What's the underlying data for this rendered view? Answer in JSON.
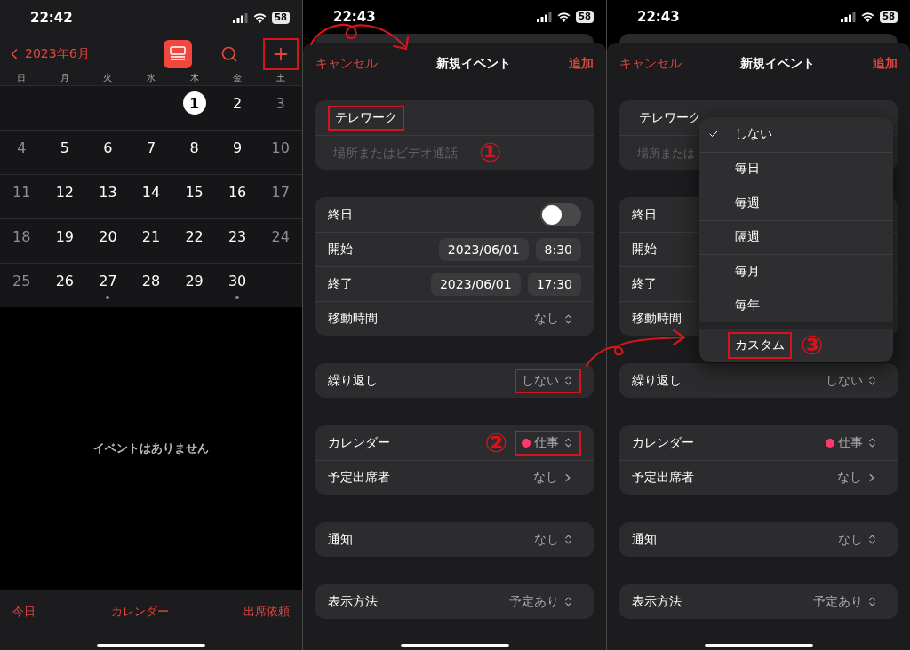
{
  "panels": [
    {
      "kind": "calendar",
      "status_bar": {
        "time": "22:42",
        "battery": "58"
      },
      "back_label": "2023年6月",
      "toolbar": [
        {
          "kind": "list",
          "selected": true,
          "highlighted": false
        },
        {
          "kind": "search",
          "selected": false,
          "highlighted": false
        },
        {
          "kind": "add",
          "selected": false,
          "highlighted": true
        }
      ],
      "weekdays": [
        "日",
        "月",
        "火",
        "水",
        "木",
        "金",
        "土"
      ],
      "weeks": [
        {
          "right_aligned": true,
          "days": [
            {
              "label": "1",
              "today": true,
              "weekend": false,
              "event": false
            },
            {
              "label": "2",
              "today": false,
              "weekend": false,
              "event": false
            },
            {
              "label": "3",
              "today": false,
              "weekend": true,
              "event": false
            }
          ]
        },
        {
          "right_aligned": false,
          "days": [
            {
              "label": "4",
              "today": false,
              "weekend": true,
              "event": false
            },
            {
              "label": "5",
              "today": false,
              "weekend": false,
              "event": false
            },
            {
              "label": "6",
              "today": false,
              "weekend": false,
              "event": false
            },
            {
              "label": "7",
              "today": false,
              "weekend": false,
              "event": false
            },
            {
              "label": "8",
              "today": false,
              "weekend": false,
              "event": false
            },
            {
              "label": "9",
              "today": false,
              "weekend": false,
              "event": false
            },
            {
              "label": "10",
              "today": false,
              "weekend": true,
              "event": false
            }
          ]
        },
        {
          "right_aligned": false,
          "days": [
            {
              "label": "11",
              "today": false,
              "weekend": true,
              "event": false
            },
            {
              "label": "12",
              "today": false,
              "weekend": false,
              "event": false
            },
            {
              "label": "13",
              "today": false,
              "weekend": false,
              "event": false
            },
            {
              "label": "14",
              "today": false,
              "weekend": false,
              "event": false
            },
            {
              "label": "15",
              "today": false,
              "weekend": false,
              "event": false
            },
            {
              "label": "16",
              "today": false,
              "weekend": false,
              "event": false
            },
            {
              "label": "17",
              "today": false,
              "weekend": true,
              "event": false
            }
          ]
        },
        {
          "right_aligned": false,
          "days": [
            {
              "label": "18",
              "today": false,
              "weekend": true,
              "event": false
            },
            {
              "label": "19",
              "today": false,
              "weekend": false,
              "event": false
            },
            {
              "label": "20",
              "today": false,
              "weekend": false,
              "event": false
            },
            {
              "label": "21",
              "today": false,
              "weekend": false,
              "event": false
            },
            {
              "label": "22",
              "today": false,
              "weekend": false,
              "event": false
            },
            {
              "label": "23",
              "today": false,
              "weekend": false,
              "event": false
            },
            {
              "label": "24",
              "today": false,
              "weekend": true,
              "event": false
            }
          ]
        },
        {
          "right_aligned": false,
          "days": [
            {
              "label": "25",
              "today": false,
              "weekend": true,
              "event": false
            },
            {
              "label": "26",
              "today": false,
              "weekend": false,
              "event": false
            },
            {
              "label": "27",
              "today": false,
              "weekend": false,
              "event": true
            },
            {
              "label": "28",
              "today": false,
              "weekend": false,
              "event": false
            },
            {
              "label": "29",
              "today": false,
              "weekend": false,
              "event": false
            },
            {
              "label": "30",
              "today": false,
              "weekend": false,
              "event": true
            }
          ]
        }
      ],
      "empty_message": "イベントはありません",
      "tabs": [
        "今日",
        "カレンダー",
        "出席依頼"
      ]
    },
    {
      "kind": "form",
      "status_bar": {
        "time": "22:43",
        "battery": "58"
      },
      "cancel": "キャンセル",
      "title": "新規イベント",
      "add": "追加",
      "groups": [
        {
          "rows": [
            {
              "kind": "text",
              "value": "テレワーク",
              "highlighted": true
            },
            {
              "kind": "placeholder",
              "placeholder": "場所またはビデオ通話",
              "callout": "①"
            }
          ]
        },
        {
          "rows": [
            {
              "kind": "toggle",
              "label": "終日",
              "on": false
            },
            {
              "kind": "datetime",
              "label": "開始",
              "date": "2023/06/01",
              "time": "8:30"
            },
            {
              "kind": "datetime",
              "label": "終了",
              "date": "2023/06/01",
              "time": "17:30"
            },
            {
              "kind": "select",
              "label": "移動時間",
              "value": "なし",
              "highlighted": false
            }
          ]
        },
        {
          "rows": [
            {
              "kind": "select",
              "label": "繰り返し",
              "value": "しない",
              "highlighted": true
            }
          ]
        },
        {
          "rows": [
            {
              "kind": "select",
              "label": "カレンダー",
              "value": "仕事",
              "color": "#ff3b6b",
              "highlighted": true,
              "callout": "②"
            },
            {
              "kind": "link",
              "label": "予定出席者",
              "value": "なし"
            }
          ]
        },
        {
          "rows": [
            {
              "kind": "select",
              "label": "通知",
              "value": "なし",
              "highlighted": false
            }
          ]
        },
        {
          "rows": [
            {
              "kind": "select",
              "label": "表示方法",
              "value": "予定あり",
              "highlighted": false
            }
          ]
        }
      ]
    },
    {
      "kind": "form",
      "status_bar": {
        "time": "22:43",
        "battery": "58"
      },
      "cancel": "キャンセル",
      "title": "新規イベント",
      "add": "追加",
      "groups": [
        {
          "rows": [
            {
              "kind": "text",
              "value": "テレワーク",
              "highlighted": false
            },
            {
              "kind": "placeholder",
              "placeholder": "場所または"
            }
          ]
        },
        {
          "rows": [
            {
              "kind": "plain",
              "label": "終日"
            },
            {
              "kind": "plain",
              "label": "開始"
            },
            {
              "kind": "plain",
              "label": "終了"
            },
            {
              "kind": "plain",
              "label": "移動時間"
            }
          ]
        },
        {
          "rows": [
            {
              "kind": "select",
              "label": "繰り返し",
              "value": "しない",
              "highlighted": false
            }
          ]
        },
        {
          "rows": [
            {
              "kind": "select",
              "label": "カレンダー",
              "value": "仕事",
              "color": "#ff3b6b",
              "highlighted": false
            },
            {
              "kind": "link",
              "label": "予定出席者",
              "value": "なし"
            }
          ]
        },
        {
          "rows": [
            {
              "kind": "select",
              "label": "通知",
              "value": "なし",
              "highlighted": false
            }
          ]
        },
        {
          "rows": [
            {
              "kind": "select",
              "label": "表示方法",
              "value": "予定あり",
              "highlighted": false
            }
          ]
        }
      ],
      "menu": {
        "items": [
          {
            "label": "しない",
            "selected": true,
            "highlighted": false
          },
          {
            "label": "毎日",
            "selected": false,
            "highlighted": false
          },
          {
            "label": "毎週",
            "selected": false,
            "highlighted": false
          },
          {
            "label": "隔週",
            "selected": false,
            "highlighted": false
          },
          {
            "label": "毎月",
            "selected": false,
            "highlighted": false
          },
          {
            "label": "毎年",
            "selected": false,
            "highlighted": false
          },
          {
            "label": "カスタム",
            "selected": false,
            "highlighted": true,
            "callout": "③"
          }
        ]
      }
    }
  ]
}
